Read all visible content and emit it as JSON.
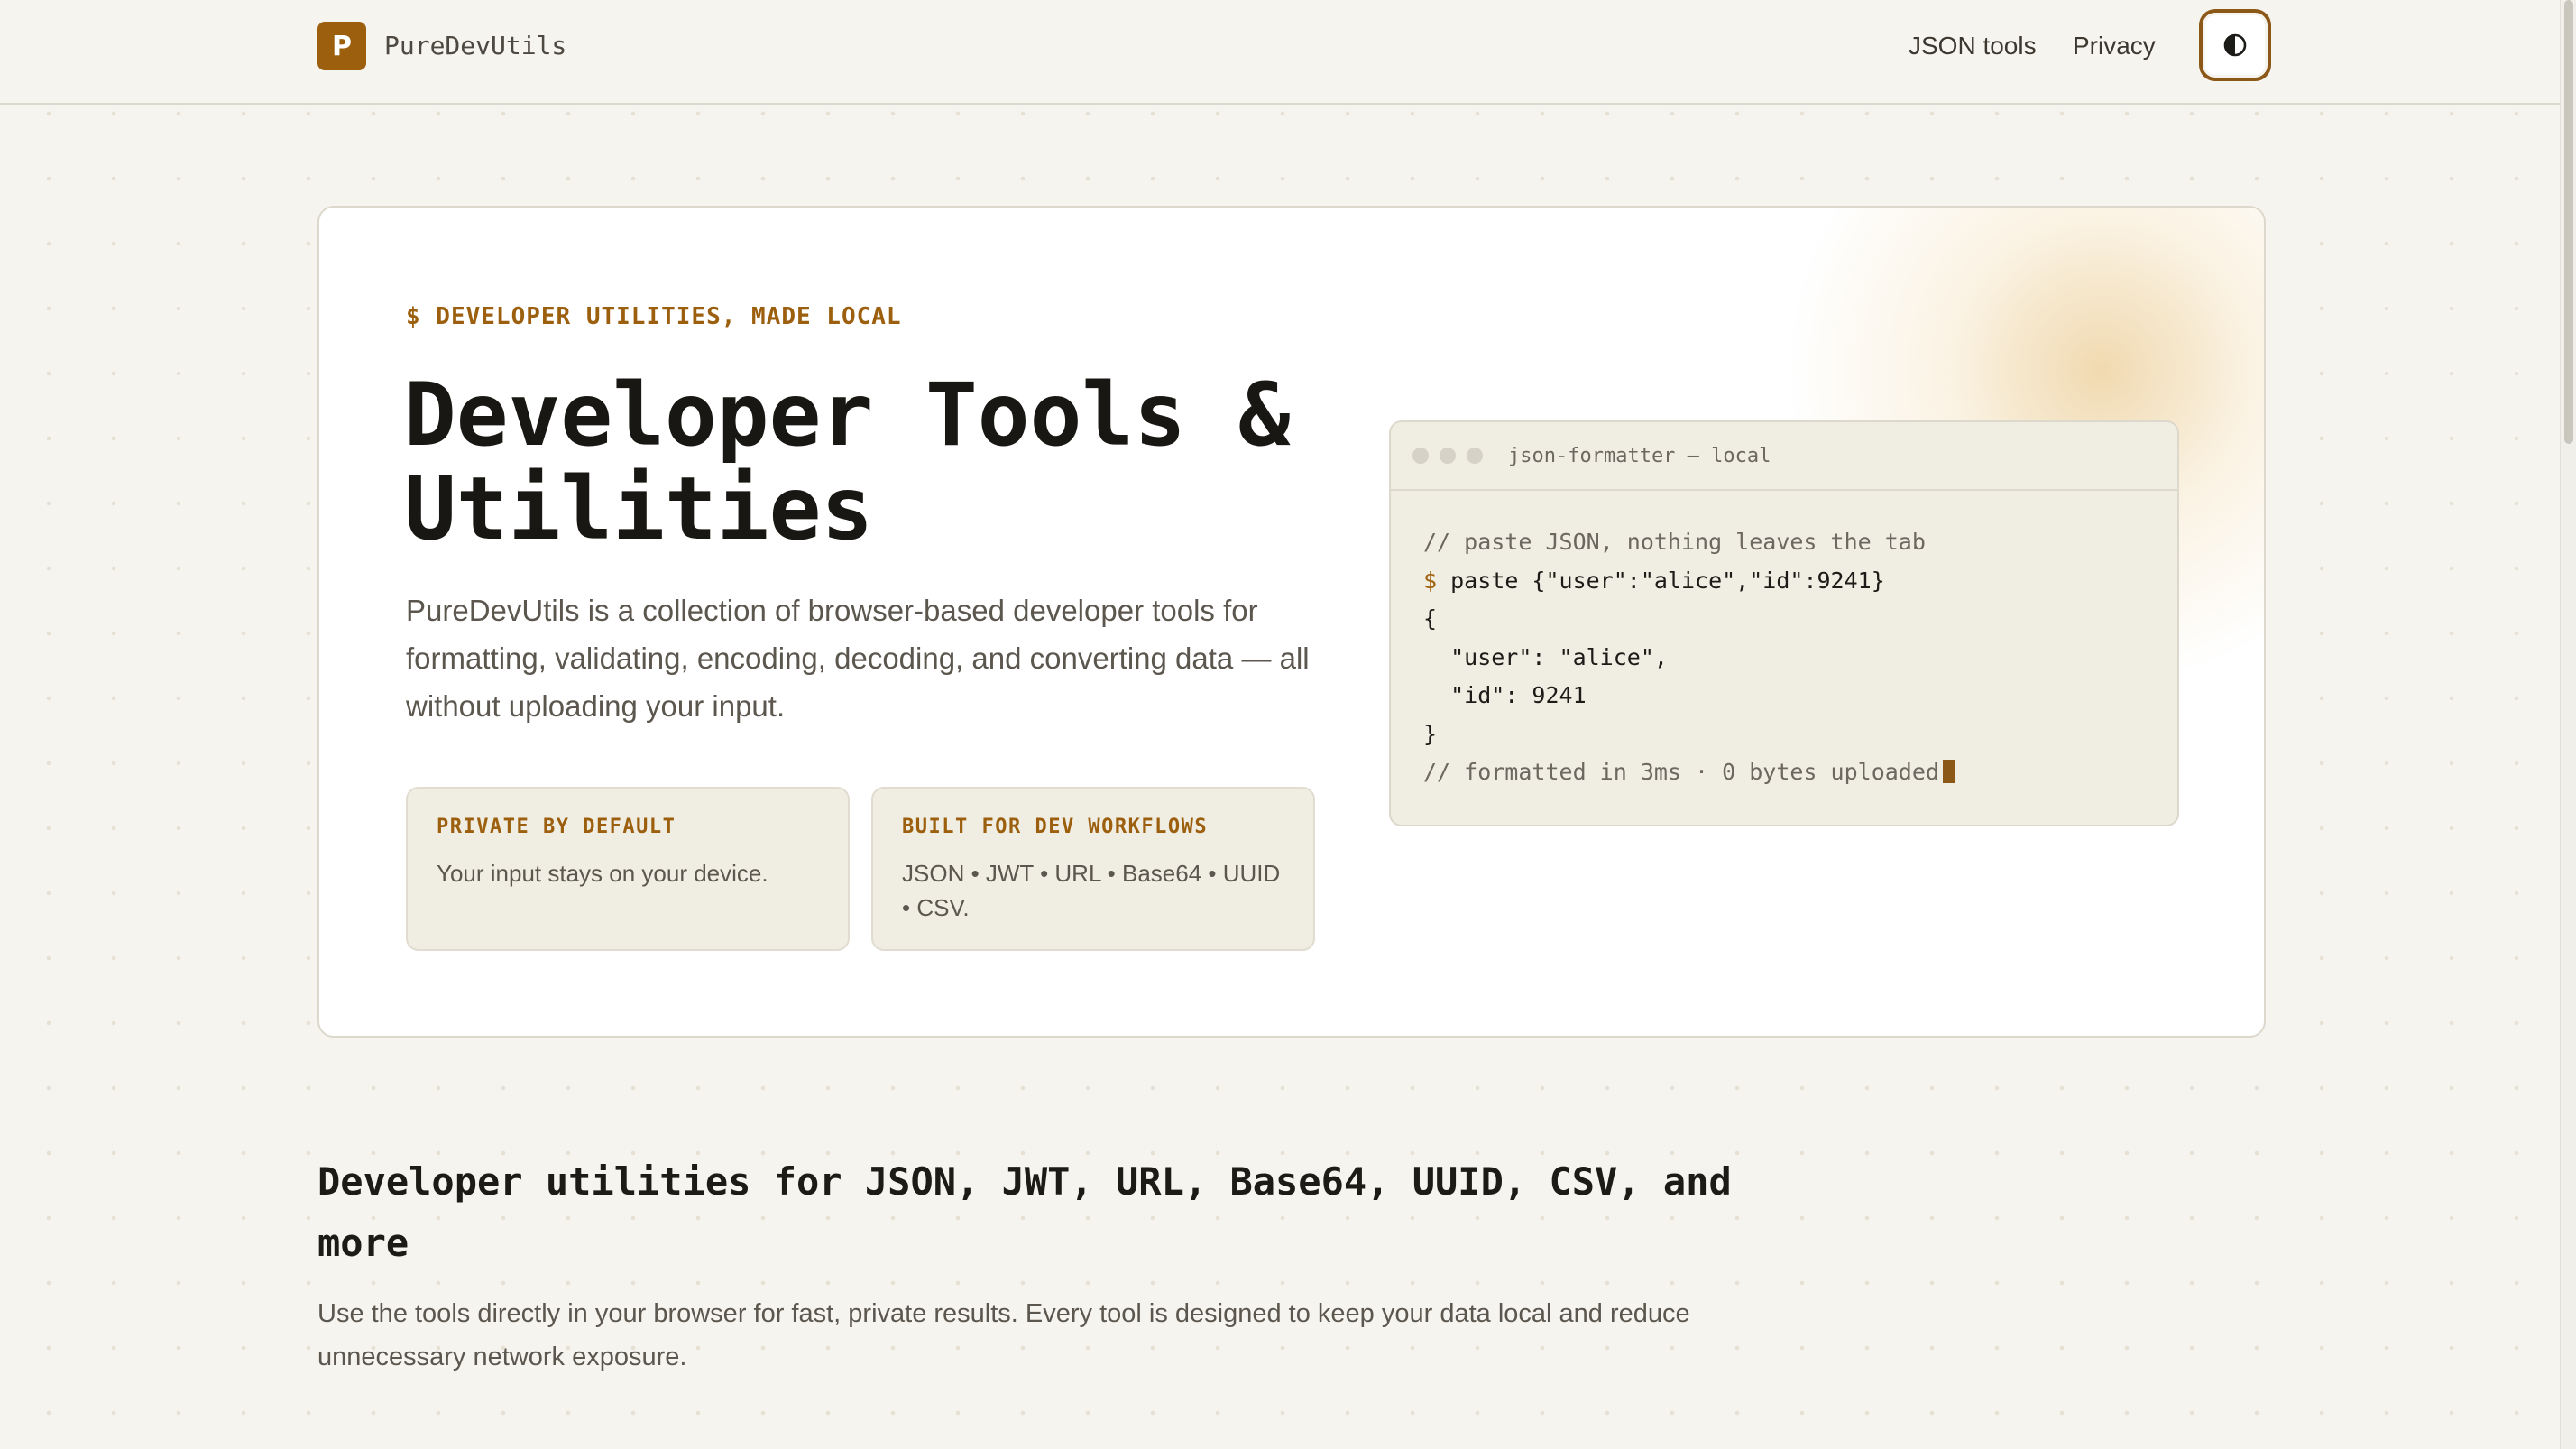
{
  "header": {
    "logo_letter": "P",
    "brand": "PureDevUtils",
    "nav": [
      {
        "label": "JSON tools"
      },
      {
        "label": "Privacy"
      }
    ],
    "theme_toggle_icon": "half-circle-contrast-icon"
  },
  "hero": {
    "eyebrow": "$ DEVELOPER UTILITIES, MADE LOCAL",
    "title_line1": "Developer Tools &",
    "title_line2": "Utilities",
    "description": "PureDevUtils is a collection of browser-based developer tools for formatting, validating, encoding, decoding, and converting data — all without uploading your input.",
    "features": [
      {
        "title": "PRIVATE BY DEFAULT",
        "text": "Your input stays on your device."
      },
      {
        "title": "BUILT FOR DEV WORKFLOWS",
        "text": "JSON • JWT • URL • Base64 • UUID • CSV."
      }
    ]
  },
  "terminal": {
    "title": "json-formatter — local",
    "lines": {
      "comment1": "// paste JSON, nothing leaves the tab",
      "prompt": "$",
      "command": " paste {\"user\":\"alice\",\"id\":9241}",
      "open_brace": "{",
      "line_user": "  \"user\": \"alice\",",
      "line_id": "  \"id\": 9241",
      "close_brace": "}",
      "comment2": "// formatted in 3ms · 0 bytes uploaded"
    }
  },
  "section": {
    "title": "Developer utilities for JSON, JWT, URL, Base64, UUID, CSV, and more",
    "description": "Use the tools directly in your browser for fast, private results. Every tool is designed to keep your data local and reduce unnecessary network exposure."
  },
  "colors": {
    "accent": "#9b5f0e",
    "background": "#f6f4ee",
    "card": "#ffffff",
    "panel": "#f0ede3"
  }
}
